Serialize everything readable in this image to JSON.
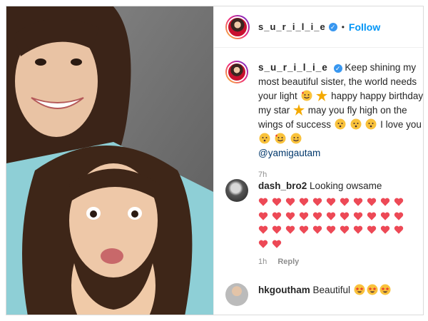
{
  "header": {
    "username": "s_u_r_i_l_i_e",
    "verified_icon": "verified-badge-icon",
    "separator": "•",
    "follow_label": "Follow"
  },
  "caption": {
    "username": "s_u_r_i_l_i_e",
    "text_1": "Keep shining my most beautiful sister, the world needs your light",
    "text_2": "happy happy birthday my star",
    "text_3": "may you fly high on the wings of success",
    "text_4": "I love you",
    "mention": "@yamigautam",
    "time": "7h"
  },
  "comments": [
    {
      "username": "dash_bro2",
      "text": "Looking owsame",
      "heart_count": 35,
      "time": "1h",
      "reply_label": "Reply"
    },
    {
      "username": "hkgoutham",
      "text": "Beautiful",
      "emoji_count": 3
    }
  ],
  "colors": {
    "follow_blue": "#0095f6",
    "verified_blue": "#3897f0",
    "heart_red": "#ed4956",
    "meta_gray": "#8e8e8e"
  }
}
